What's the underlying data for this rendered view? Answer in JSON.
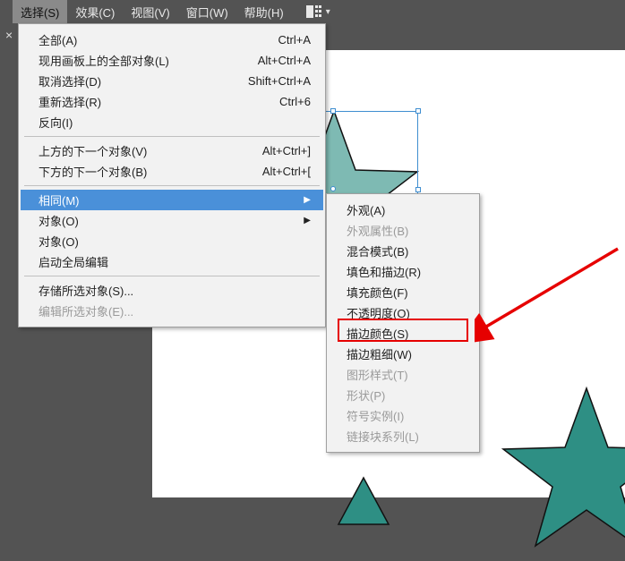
{
  "menubar": {
    "items": [
      {
        "label": "选择(S)",
        "active": true
      },
      {
        "label": "效果(C)",
        "active": false
      },
      {
        "label": "视图(V)",
        "active": false
      },
      {
        "label": "窗口(W)",
        "active": false
      },
      {
        "label": "帮助(H)",
        "active": false
      }
    ]
  },
  "main_menu": {
    "rows": [
      {
        "kind": "item",
        "label": "全部(A)",
        "shortcut": "Ctrl+A"
      },
      {
        "kind": "item",
        "label": "现用画板上的全部对象(L)",
        "shortcut": "Alt+Ctrl+A"
      },
      {
        "kind": "item",
        "label": "取消选择(D)",
        "shortcut": "Shift+Ctrl+A"
      },
      {
        "kind": "item",
        "label": "重新选择(R)",
        "shortcut": "Ctrl+6"
      },
      {
        "kind": "item",
        "label": "反向(I)",
        "shortcut": ""
      },
      {
        "kind": "sep"
      },
      {
        "kind": "item",
        "label": "上方的下一个对象(V)",
        "shortcut": "Alt+Ctrl+]"
      },
      {
        "kind": "item",
        "label": "下方的下一个对象(B)",
        "shortcut": "Alt+Ctrl+["
      },
      {
        "kind": "sep"
      },
      {
        "kind": "submenu",
        "label": "相同(M)",
        "highlight": true
      },
      {
        "kind": "submenu",
        "label": "对象(O)",
        "highlight": false
      },
      {
        "kind": "item",
        "label": "对象(O)",
        "shortcut": ""
      },
      {
        "kind": "item",
        "label": "启动全局编辑",
        "shortcut": ""
      },
      {
        "kind": "sep"
      },
      {
        "kind": "item",
        "label": "存储所选对象(S)...",
        "shortcut": ""
      },
      {
        "kind": "item",
        "label": "编辑所选对象(E)...",
        "shortcut": "",
        "disabled": true
      }
    ]
  },
  "sub_menu": {
    "rows": [
      {
        "label": "外观(A)",
        "disabled": false
      },
      {
        "label": "外观属性(B)",
        "disabled": true
      },
      {
        "label": "混合模式(B)",
        "disabled": false
      },
      {
        "label": "填色和描边(R)",
        "disabled": false
      },
      {
        "label": "填充颜色(F)",
        "disabled": false
      },
      {
        "label": "不透明度(O)",
        "disabled": false
      },
      {
        "label": "描边颜色(S)",
        "disabled": false
      },
      {
        "label": "描边粗细(W)",
        "disabled": false
      },
      {
        "label": "图形样式(T)",
        "disabled": true
      },
      {
        "label": "形状(P)",
        "disabled": true
      },
      {
        "label": "符号实例(I)",
        "disabled": true
      },
      {
        "label": "链接块系列(L)",
        "disabled": true
      }
    ]
  },
  "colors": {
    "star_fill": "#2e8f84",
    "star_stroke": "#111111",
    "highlight": "#4a90d9",
    "annotation_red": "#e60000"
  }
}
